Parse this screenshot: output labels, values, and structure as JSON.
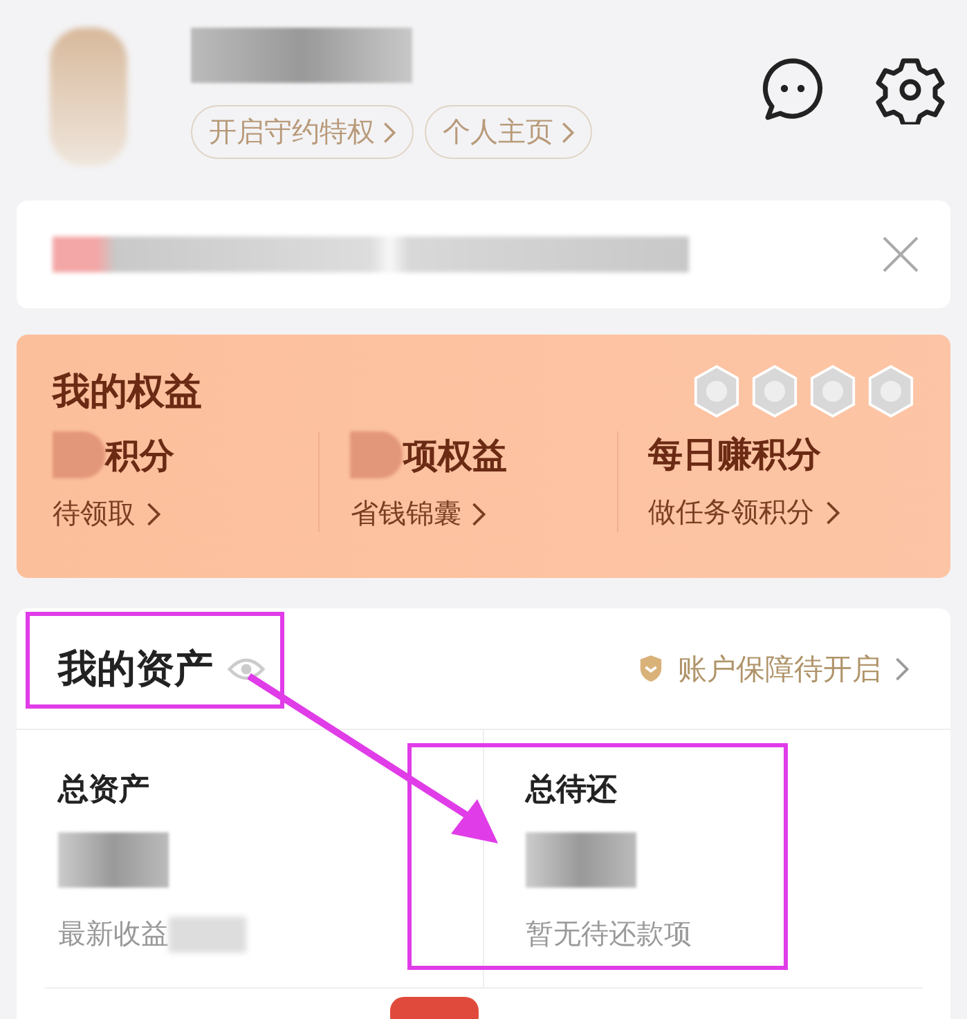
{
  "profile": {
    "buttons": [
      "开启守约特权",
      "个人主页"
    ]
  },
  "benefits": {
    "title": "我的权益",
    "items": [
      {
        "kind": "masked",
        "title": "积分",
        "subtitle": "待领取"
      },
      {
        "kind": "masked",
        "title": "项权益",
        "subtitle": "省钱锦囊"
      },
      {
        "kind": "plain",
        "title": "每日赚积分",
        "subtitle": "做任务领积分"
      }
    ]
  },
  "assets": {
    "title": "我的资产",
    "protection": "账户保障待开启",
    "items": [
      {
        "label": "总资产",
        "note": "最新收益",
        "note_masked": true
      },
      {
        "label": "总待还",
        "note": "暂无待还款项",
        "note_masked": false
      }
    ]
  }
}
